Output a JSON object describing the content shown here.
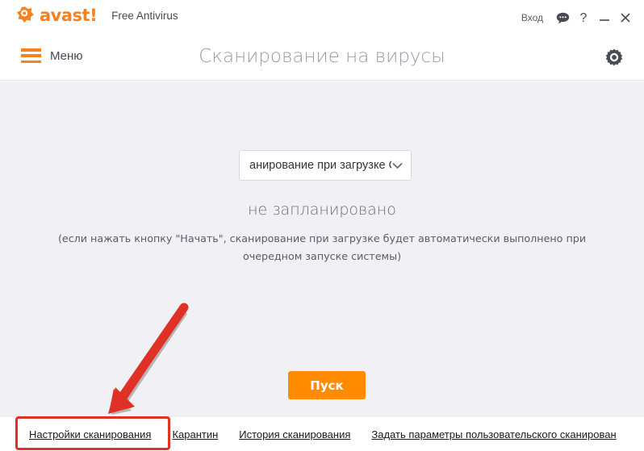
{
  "window": {
    "brand_word": "avast!",
    "brand_mark_icon": "avast-ball-icon",
    "product_name": "Free Antivirus",
    "login_label": "Вход",
    "chat_icon": "speech-bubble-icon",
    "help_icon": "question-mark-icon",
    "minimize_icon": "minimize-icon",
    "close_icon": "close-icon"
  },
  "header": {
    "menu_icon": "hamburger-icon",
    "menu_label": "Меню",
    "title": "Сканирование на вирусы",
    "settings_icon": "gear-icon"
  },
  "main": {
    "scan_select": {
      "value": "анирование при загрузке С",
      "chevron_icon": "chevron-down-icon"
    },
    "status": "не запланировано",
    "hint": "(если нажать кнопку \"Начать\", сканирование при загрузке будет автоматически выполнено при очередном запуске системы)",
    "start_button": "Пуск"
  },
  "footer": {
    "links": [
      {
        "label": "Настройки сканирования",
        "highlighted": true
      },
      {
        "label": "Карантин",
        "highlighted": false
      },
      {
        "label": "История сканирования",
        "highlighted": false
      },
      {
        "label": "Задать параметры пользовательского сканирован",
        "highlighted": false
      }
    ]
  },
  "annotations": {
    "highlight_color": "#e03127",
    "arrow_icon": "red-arrow-pointing-down-left",
    "box_target": "Настройки сканирования"
  },
  "colors": {
    "brand_orange": "#f58220",
    "button_orange": "#ff8c00",
    "content_bg": "#f1f0f5",
    "annotation_red": "#e03127"
  }
}
